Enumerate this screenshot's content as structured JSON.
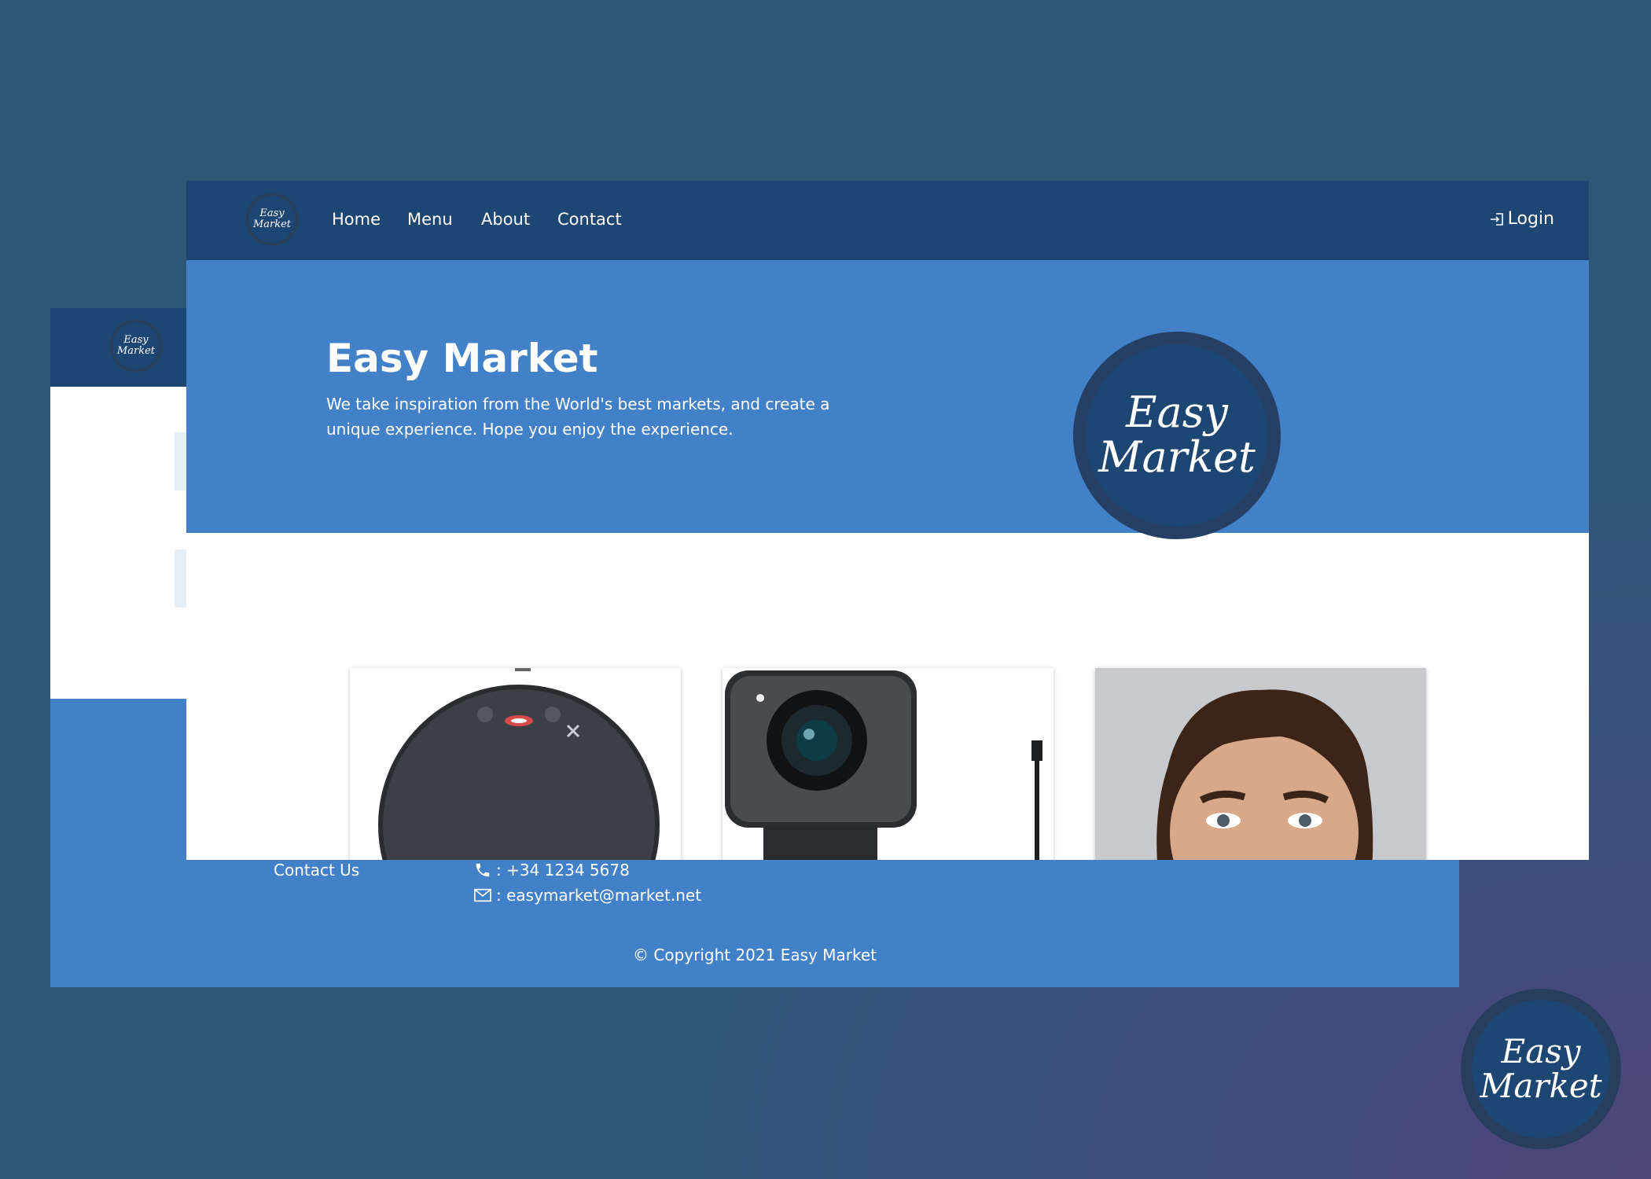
{
  "brand": {
    "logo_line1": "Easy",
    "logo_line2": "Market"
  },
  "nav": {
    "items": [
      "Home",
      "Menu",
      "About",
      "Contact"
    ],
    "login_label": "Login"
  },
  "hero": {
    "title": "Easy Market",
    "text": "We take inspiration from the World's best markets, and create a unique experience. Hope you enjoy the experience."
  },
  "products": [
    {
      "image": "smart-speaker"
    },
    {
      "image": "webcam"
    },
    {
      "image": "person-portrait"
    }
  ],
  "footer": {
    "contact_label": "Contact Us",
    "phone": ": +34 1234 5678",
    "email": ": easymarket@market.net",
    "copyright": "© Copyright 2021 Easy Market"
  },
  "colors": {
    "nav": "#1e4673",
    "hero": "#4281c8",
    "background": "#2e5676"
  }
}
